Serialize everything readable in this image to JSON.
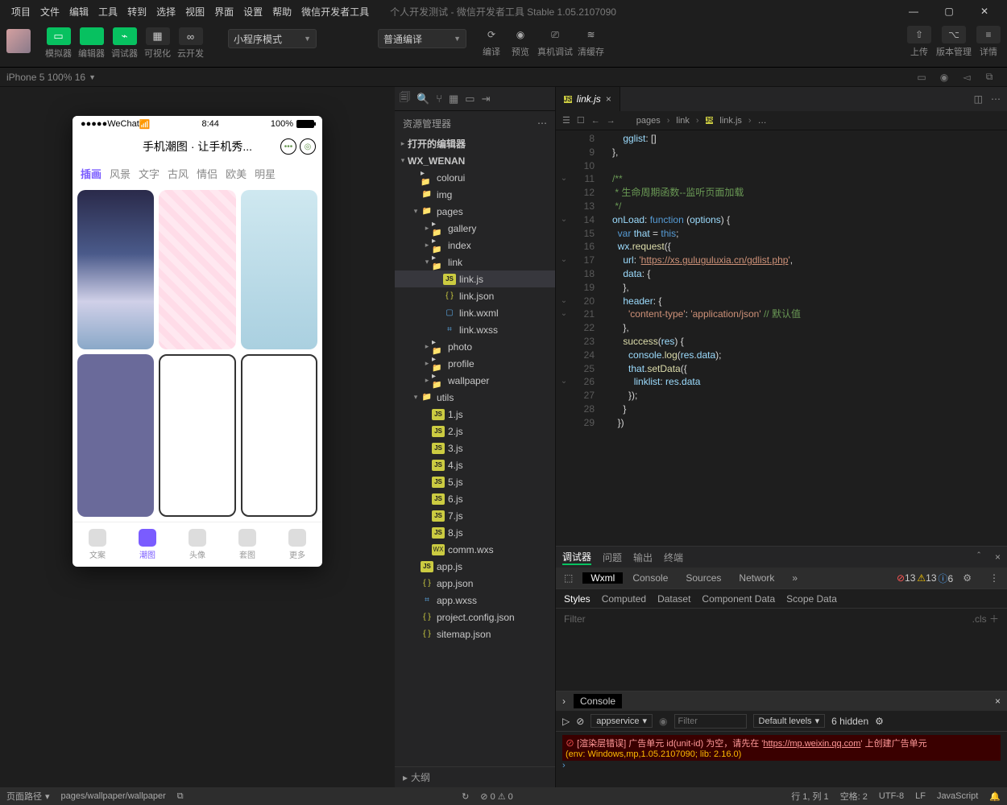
{
  "menu": [
    "项目",
    "文件",
    "编辑",
    "工具",
    "转到",
    "选择",
    "视图",
    "界面",
    "设置",
    "帮助",
    "微信开发者工具"
  ],
  "window_title": "个人开发测试 - 微信开发者工具 Stable 1.05.2107090",
  "toolbar": {
    "buttons": [
      {
        "label": "模拟器",
        "glyph": "▭",
        "green": true
      },
      {
        "label": "编辑器",
        "glyph": "</>",
        "green": true
      },
      {
        "label": "调试器",
        "glyph": "⌁",
        "green": true
      },
      {
        "label": "可视化",
        "glyph": "▦"
      },
      {
        "label": "云开发",
        "glyph": "∞"
      }
    ],
    "mode_dropdown": "小程序模式",
    "compile_dropdown": "普通编译",
    "actions": [
      {
        "label": "编译",
        "glyph": "⟳"
      },
      {
        "label": "预览",
        "glyph": "◉"
      },
      {
        "label": "真机调试",
        "glyph": "⎚"
      },
      {
        "label": "清缓存",
        "glyph": "≋"
      }
    ],
    "right_actions": [
      {
        "label": "上传",
        "glyph": "⇧"
      },
      {
        "label": "版本管理",
        "glyph": "⌥"
      },
      {
        "label": "详情",
        "glyph": "≡"
      }
    ]
  },
  "device_bar": {
    "text": "iPhone 5 100% 16"
  },
  "explorer": {
    "title": "资源管理器",
    "sections": [
      "打开的编辑器",
      "WX_WENAN"
    ],
    "tree": [
      {
        "d": 1,
        "t": "folder",
        "n": "colorui",
        "tw": ""
      },
      {
        "d": 1,
        "t": "folder-g",
        "n": "img",
        "tw": ""
      },
      {
        "d": 1,
        "t": "folder-g",
        "n": "pages",
        "tw": "▾"
      },
      {
        "d": 2,
        "t": "folder",
        "n": "gallery",
        "tw": "▸"
      },
      {
        "d": 2,
        "t": "folder",
        "n": "index",
        "tw": "▸"
      },
      {
        "d": 2,
        "t": "folder",
        "n": "link",
        "tw": "▾"
      },
      {
        "d": 3,
        "t": "js",
        "n": "link.js",
        "sel": true
      },
      {
        "d": 3,
        "t": "json",
        "n": "link.json"
      },
      {
        "d": 3,
        "t": "wxml",
        "n": "link.wxml"
      },
      {
        "d": 3,
        "t": "wxss",
        "n": "link.wxss"
      },
      {
        "d": 2,
        "t": "folder",
        "n": "photo",
        "tw": "▸"
      },
      {
        "d": 2,
        "t": "folder",
        "n": "profile",
        "tw": "▸"
      },
      {
        "d": 2,
        "t": "folder",
        "n": "wallpaper",
        "tw": "▸"
      },
      {
        "d": 1,
        "t": "folder-g",
        "n": "utils",
        "tw": "▾"
      },
      {
        "d": 2,
        "t": "js",
        "n": "1.js"
      },
      {
        "d": 2,
        "t": "js",
        "n": "2.js"
      },
      {
        "d": 2,
        "t": "js",
        "n": "3.js"
      },
      {
        "d": 2,
        "t": "js",
        "n": "4.js"
      },
      {
        "d": 2,
        "t": "js",
        "n": "5.js"
      },
      {
        "d": 2,
        "t": "js",
        "n": "6.js"
      },
      {
        "d": 2,
        "t": "js",
        "n": "7.js"
      },
      {
        "d": 2,
        "t": "js",
        "n": "8.js"
      },
      {
        "d": 2,
        "t": "wxs",
        "n": "comm.wxs"
      },
      {
        "d": 1,
        "t": "js",
        "n": "app.js"
      },
      {
        "d": 1,
        "t": "json",
        "n": "app.json"
      },
      {
        "d": 1,
        "t": "wxss",
        "n": "app.wxss"
      },
      {
        "d": 1,
        "t": "json",
        "n": "project.config.json"
      },
      {
        "d": 1,
        "t": "json",
        "n": "sitemap.json"
      }
    ],
    "outline": "大纲"
  },
  "editor": {
    "tab": "link.js",
    "breadcrumb": [
      "pages",
      "link",
      "link.js",
      "…"
    ],
    "first_line": 8,
    "code": [
      [
        [
          "n",
          "       gglist"
        ],
        [
          "p",
          ": []"
        ]
      ],
      [
        [
          "p",
          "   },"
        ]
      ],
      [
        [
          "p",
          ""
        ]
      ],
      [
        [
          "c",
          "   /**"
        ]
      ],
      [
        [
          "c",
          "    * 生命周期函数--监听页面加载"
        ]
      ],
      [
        [
          "c",
          "    */"
        ]
      ],
      [
        [
          "n",
          "   onLoad"
        ],
        [
          "p",
          ": "
        ],
        [
          "b",
          "function"
        ],
        [
          "p",
          " ("
        ],
        [
          "n",
          "options"
        ],
        [
          "p",
          ") {"
        ]
      ],
      [
        [
          "p",
          "     "
        ],
        [
          "b",
          "var"
        ],
        [
          "p",
          " "
        ],
        [
          "n",
          "that"
        ],
        [
          "p",
          " = "
        ],
        [
          "b",
          "this"
        ],
        [
          "p",
          ";"
        ]
      ],
      [
        [
          "p",
          "     "
        ],
        [
          "n",
          "wx"
        ],
        [
          "p",
          "."
        ],
        [
          "f",
          "request"
        ],
        [
          "p",
          "({"
        ]
      ],
      [
        [
          "p",
          "       "
        ],
        [
          "n",
          "url"
        ],
        [
          "p",
          ": "
        ],
        [
          "s",
          "'"
        ],
        [
          "s u",
          "https://xs.guluguluxia.cn/gdlist.php"
        ],
        [
          "s",
          "'"
        ],
        [
          "p",
          ","
        ]
      ],
      [
        [
          "p",
          "       "
        ],
        [
          "n",
          "data"
        ],
        [
          "p",
          ": {"
        ]
      ],
      [
        [
          "p",
          "       },"
        ]
      ],
      [
        [
          "p",
          "       "
        ],
        [
          "n",
          "header"
        ],
        [
          "p",
          ": {"
        ]
      ],
      [
        [
          "p",
          "         "
        ],
        [
          "s",
          "'content-type'"
        ],
        [
          "p",
          ": "
        ],
        [
          "s",
          "'application/json'"
        ],
        [
          "p",
          " "
        ],
        [
          "c",
          "// 默认值"
        ]
      ],
      [
        [
          "p",
          "       },"
        ]
      ],
      [
        [
          "p",
          "       "
        ],
        [
          "f",
          "success"
        ],
        [
          "p",
          "("
        ],
        [
          "n",
          "res"
        ],
        [
          "p",
          ") {"
        ]
      ],
      [
        [
          "p",
          "         "
        ],
        [
          "n",
          "console"
        ],
        [
          "p",
          "."
        ],
        [
          "f",
          "log"
        ],
        [
          "p",
          "("
        ],
        [
          "n",
          "res"
        ],
        [
          "p",
          "."
        ],
        [
          "n",
          "data"
        ],
        [
          "p",
          ");"
        ]
      ],
      [
        [
          "p",
          "         "
        ],
        [
          "n",
          "that"
        ],
        [
          "p",
          "."
        ],
        [
          "f",
          "setData"
        ],
        [
          "p",
          "({"
        ]
      ],
      [
        [
          "p",
          "           "
        ],
        [
          "n",
          "linklist"
        ],
        [
          "p",
          ": "
        ],
        [
          "n",
          "res"
        ],
        [
          "p",
          "."
        ],
        [
          "n",
          "data"
        ]
      ],
      [
        [
          "p",
          "         });"
        ]
      ],
      [
        [
          "p",
          "       }"
        ]
      ],
      [
        [
          "p",
          "     })"
        ]
      ]
    ]
  },
  "phone": {
    "carrier": "WeChat",
    "time": "8:44",
    "battery": "100%",
    "title": "手机潮图 · 让手机秀...",
    "tabs": [
      "插画",
      "风景",
      "文字",
      "古风",
      "情侣",
      "欧美",
      "明星"
    ],
    "tabbar": [
      "文案",
      "潮图",
      "头像",
      "套图",
      "更多"
    ],
    "active_tab": 0,
    "active_nav": 1
  },
  "debugger": {
    "tabs": [
      "调试器",
      "问题",
      "输出",
      "终端"
    ],
    "devtabs": [
      "Wxml",
      "Console",
      "Sources",
      "Network"
    ],
    "counts": {
      "err": "13",
      "warn": "13",
      "info": "6"
    },
    "style_tabs": [
      "Styles",
      "Computed",
      "Dataset",
      "Component Data",
      "Scope Data"
    ],
    "filter": "Filter",
    "cls": ".cls"
  },
  "console": {
    "tab": "Console",
    "context": "appservice",
    "filter": "Filter",
    "levels": "Default levels",
    "hidden": "6 hidden",
    "err_pre": "[渲染层错误] 广告单元 id(unit-id) 为空，请先在 '",
    "err_link": "https://mp.weixin.qq.com",
    "err_post": "' 上创建广告单元",
    "env": "(env: Windows,mp,1.05.2107090; lib: 2.16.0)"
  },
  "status": {
    "route_label": "页面路径",
    "route": "pages/wallpaper/wallpaper",
    "diag": "⊘ 0 ⚠ 0",
    "ln": "行 1, 列 1",
    "spaces": "空格: 2",
    "enc": "UTF-8",
    "eol": "LF",
    "lang": "JavaScript"
  }
}
